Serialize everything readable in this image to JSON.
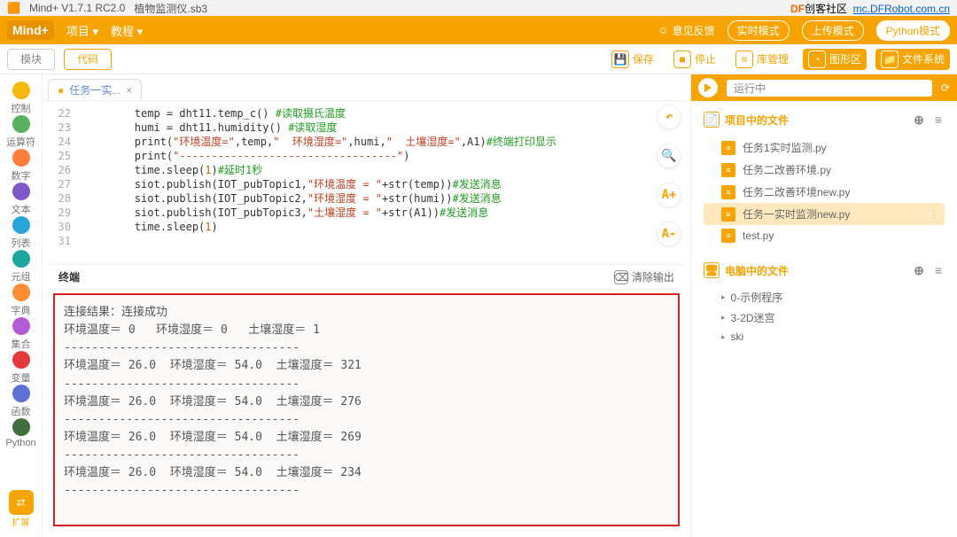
{
  "titlebar": {
    "app": "Mind+ V1.7.1 RC2.0",
    "file": "植物监测仪.sb3",
    "brand_prefix": "DF",
    "brand_suffix": "创客社区",
    "url": "mc.DFRobot.com.cn"
  },
  "menubar": {
    "logo": "Mind+",
    "items": [
      "项目 ▾",
      "教程 ▾"
    ],
    "feedback": "意见反馈",
    "pills": [
      "实时模式",
      "上传模式",
      "Python模式"
    ]
  },
  "topbar": {
    "tabs": [
      "模块",
      "代码"
    ],
    "tools": {
      "save": "保存",
      "stop": "停止",
      "libs": "库管理",
      "chart": "图形区",
      "fs": "文件系统"
    }
  },
  "left": {
    "items": [
      {
        "label": "控制",
        "color": "#f5b90f"
      },
      {
        "label": "运算符",
        "color": "#5ab060"
      },
      {
        "label": "数字",
        "color": "#ff7d3b"
      },
      {
        "label": "文本",
        "color": "#8057c7"
      },
      {
        "label": "列表",
        "color": "#2aa5da"
      },
      {
        "label": "元组",
        "color": "#1da6a0"
      },
      {
        "label": "字典",
        "color": "#ff8b34"
      },
      {
        "label": "集合",
        "color": "#b45cd6"
      },
      {
        "label": "变量",
        "color": "#e33b3b"
      },
      {
        "label": "函数",
        "color": "#5c70d6"
      },
      {
        "label": "Python",
        "color": "#3f6f3f"
      }
    ],
    "extension": "扩展"
  },
  "editor": {
    "tabname": "任务一实...",
    "lines": [
      {
        "n": 22,
        "html": "        temp = dht11.temp_c() <span class='cmt'>#读取摄氏温度</span>"
      },
      {
        "n": 23,
        "html": "        humi = dht11.humidity() <span class='cmt'>#读取湿度</span>"
      },
      {
        "n": 24,
        "html": "        print(<span class='str'>\"环境温度=\"</span>,temp,<span class='str'>\"  环境湿度=\"</span>,humi,<span class='str'>\"  土壤湿度=\"</span>,A1)<span class='cmt'>#终端打印显示</span>"
      },
      {
        "n": 25,
        "html": "        print(<span class='str'>\"----------------------------------\"</span>)"
      },
      {
        "n": 26,
        "html": "        time.sleep(<span class='num'>1</span>)<span class='cmt'>#延时1秒</span>"
      },
      {
        "n": 27,
        "html": "        siot.publish(IOT_pubTopic1,<span class='str'>\"环境温度 = \"</span>+str(temp))<span class='cmt'>#发送消息</span>"
      },
      {
        "n": 28,
        "html": "        siot.publish(IOT_pubTopic2,<span class='str'>\"环境湿度 = \"</span>+str(humi))<span class='cmt'>#发送消息</span>"
      },
      {
        "n": 29,
        "html": "        siot.publish(IOT_pubTopic3,<span class='str'>\"土壤湿度 = \"</span>+str(A1))<span class='cmt'>#发送消息</span>"
      },
      {
        "n": 30,
        "html": "        time.sleep(<span class='num'>1</span>)"
      },
      {
        "n": 31,
        "html": ""
      }
    ],
    "buttons": {
      "undo": "↶",
      "search": "🔍",
      "fontplus": "A+",
      "fontminus": "A-",
      "collapse": "⟐"
    }
  },
  "terminal": {
    "title": "终端",
    "clear": "清除输出",
    "lines": [
      "连接结果：连接成功",
      "环境温度＝ 0   环境湿度＝ 0   土壤湿度＝ 1",
      "---",
      "环境温度＝ 26.0  环境湿度＝ 54.0  土壤湿度＝ 321",
      "---",
      "环境温度＝ 26.0  环境湿度＝ 54.0  土壤湿度＝ 276",
      "---",
      "环境温度＝ 26.0  环境湿度＝ 54.0  土壤湿度＝ 269",
      "---",
      "环境温度＝ 26.0  环境湿度＝ 54.0  土壤湿度＝ 234",
      "---"
    ]
  },
  "rightpane": {
    "running": "运行中",
    "proj_header": "项目中的文件",
    "files": [
      "任务1实时监测.py",
      "任务二改善环境.py",
      "任务二改善环境new.py",
      "任务一实时监测new.py",
      "test.py"
    ],
    "active_index": 3,
    "pc_header": "电脑中的文件",
    "folders": [
      "0-示例程序",
      "3-2D迷宫",
      "ski"
    ]
  }
}
